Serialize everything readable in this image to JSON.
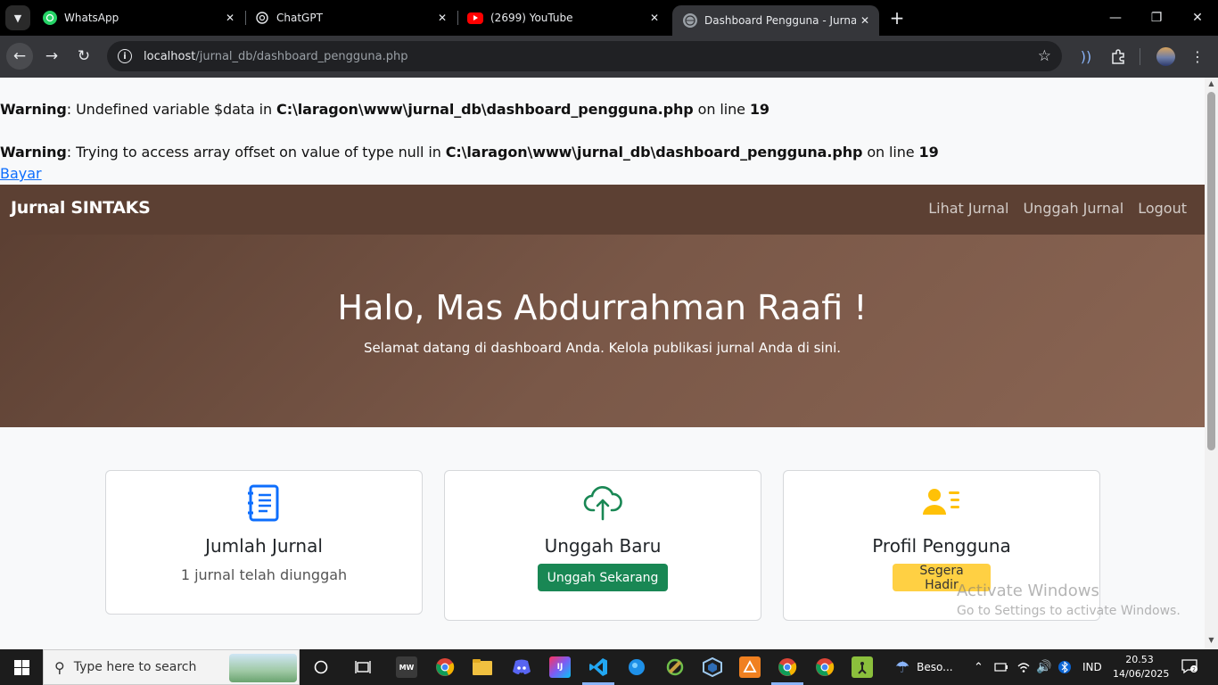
{
  "browser": {
    "tabs": [
      {
        "title": "WhatsApp",
        "icon": "whatsapp-icon"
      },
      {
        "title": "ChatGPT",
        "icon": "chatgpt-icon"
      },
      {
        "title": "(2699) YouTube",
        "icon": "youtube-icon"
      },
      {
        "title": "Dashboard Pengguna - Jurnal S",
        "icon": "globe-icon",
        "active": true
      }
    ],
    "url_host": "localhost",
    "url_path": "/jurnal_db/dashboard_pengguna.php"
  },
  "warnings": [
    {
      "label": "Warning",
      "message": ": Undefined variable $data in ",
      "path": "C:\\laragon\\www\\jurnal_db\\dashboard_pengguna.php",
      "on_line": " on line ",
      "line": "19"
    },
    {
      "label": "Warning",
      "message": ": Trying to access array offset on value of type null in ",
      "path": "C:\\laragon\\www\\jurnal_db\\dashboard_pengguna.php",
      "on_line": " on line ",
      "line": "19"
    }
  ],
  "bayar_link": "Bayar",
  "navbar": {
    "brand": "Jurnal SINTAKS",
    "links": [
      "Lihat Jurnal",
      "Unggah Jurnal",
      "Logout"
    ],
    "color": "#5c4033"
  },
  "hero": {
    "title": "Halo, Mas Abdurrahman Raafi !",
    "subtitle": "Selamat datang di dashboard Anda. Kelola publikasi jurnal Anda di sini."
  },
  "cards": [
    {
      "title": "Jumlah Jurnal",
      "subtitle": "1 jurnal telah diunggah",
      "icon": "journal-icon",
      "color": "#0d6efd"
    },
    {
      "title": "Unggah Baru",
      "button": "Unggah Sekarang",
      "icon": "cloud-upload-icon",
      "color": "#198754"
    },
    {
      "title": "Profil Pengguna",
      "button": "Segera Hadir",
      "icon": "user-profile-icon",
      "color": "#ffc107"
    }
  ],
  "watermark": {
    "line1": "Activate Windows",
    "line2": "Go to Settings to activate Windows."
  },
  "taskbar": {
    "search_placeholder": "Type here to search",
    "weather": "Beso...",
    "language": "IND",
    "time": "20.53",
    "date": "14/06/2025"
  }
}
